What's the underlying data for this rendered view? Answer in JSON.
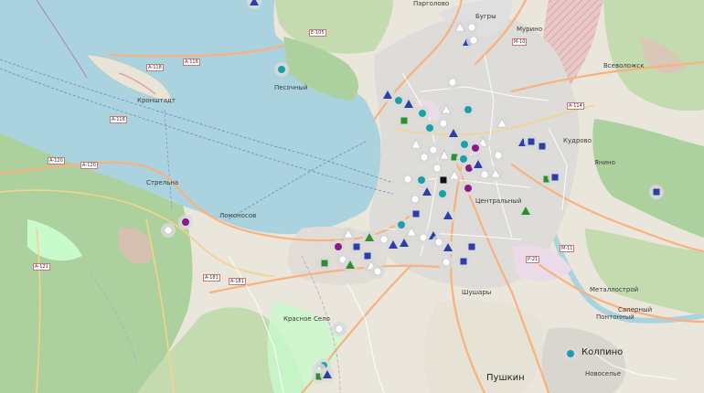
{
  "map": {
    "colors": {
      "water": "#aad3df",
      "land": "#eae6dc",
      "forest": "#add19e",
      "park": "#c8facc",
      "urban": "#e0dfdf",
      "industrial": "#ebdbe8",
      "road_major": "#f8b27f",
      "road_minor": "#ffffff",
      "marker_blue": "#2c3ea8",
      "marker_teal": "#1aa1a8",
      "marker_purple": "#8a1a8a",
      "marker_green": "#2f8f2f",
      "marker_gray": "#d9d9d9"
    },
    "labels": {
      "kronshtadt": "Кронштадт",
      "lomonosov": "Ломоносов",
      "pushkin": "Пушкин",
      "kolpino": "Колпино",
      "metallostroy": "Металлострой",
      "murino": "Мурино",
      "kudrovo": "Кудрово",
      "vsevolozhsk": "Всеволожск",
      "bugry": "Бугры",
      "yanino": "Янино",
      "sapernyi": "Саперный",
      "shushary": "Шушары",
      "strelna": "Стрельна",
      "krasnoye_selo": "Красное Село",
      "pargolovo": "Парголово",
      "pontonny": "Понтонный",
      "novoselye": "Новоселье",
      "pesochny": "Песочный",
      "tsentralnyi": "Центральный"
    },
    "road_shields": [
      "А-118",
      "А-118",
      "А-118",
      "А-120",
      "А-120",
      "А-121",
      "А-181",
      "А-181",
      "Р-21",
      "М-10",
      "М-11",
      "А-114",
      "Е-105"
    ],
    "marker_kinds": [
      "blue-triangle",
      "teal-circle",
      "purple-circle",
      "green-square",
      "green-triangle",
      "gray-circle",
      "gray-triangle",
      "black-square"
    ]
  }
}
